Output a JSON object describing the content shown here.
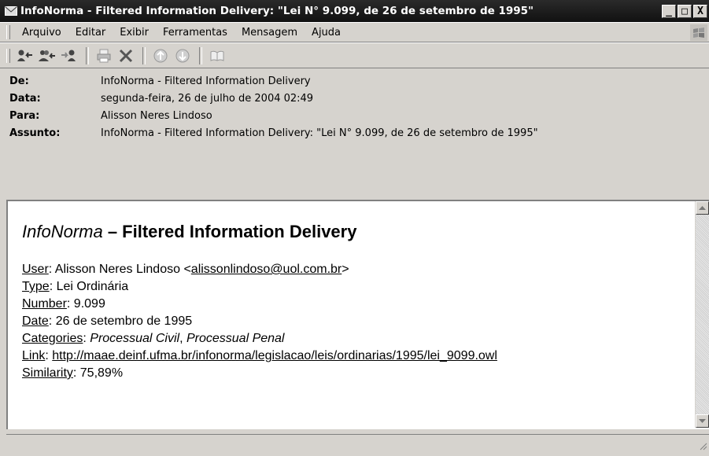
{
  "window": {
    "title": "InfoNorma - Filtered Information Delivery: \"Lei N° 9.099, de 26 de setembro de 1995\"",
    "app_icon": "envelope-icon",
    "buttons": [
      "minimize",
      "maximize",
      "close"
    ],
    "minimize_glyph": "_",
    "maximize_glyph": "□",
    "close_glyph": "X"
  },
  "menubar": {
    "items": [
      "Arquivo",
      "Editar",
      "Exibir",
      "Ferramentas",
      "Mensagem",
      "Ajuda"
    ],
    "logo_icon": "windows-flag-icon"
  },
  "toolbar": {
    "buttons": [
      "reply-icon",
      "reply-all-icon",
      "forward-icon",
      "print-icon",
      "delete-icon",
      "previous-icon",
      "next-icon",
      "addresses-icon"
    ]
  },
  "headers": {
    "from_label": "De:",
    "from_value": "InfoNorma - Filtered Information Delivery",
    "date_label": "Data:",
    "date_value": "segunda-feira, 26 de julho de 2004 02:49",
    "to_label": "Para:",
    "to_value": "Alisson Neres Lindoso",
    "subject_label": "Assunto:",
    "subject_value": "InfoNorma - Filtered Information Delivery: \"Lei N° 9.099, de 26 de setembro de 1995\""
  },
  "message": {
    "title_brand": "InfoNorma",
    "title_rest": " – Filtered Information Delivery",
    "user_label": "User",
    "user_name": "Alisson Neres Lindoso",
    "user_email": "alissonlindoso@uol.com.br",
    "type_label": "Type",
    "type_value": "Lei Ordinária",
    "number_label": "Number",
    "number_value": "9.099",
    "date_label": "Date",
    "date_value": "26 de setembro de 1995",
    "categories_label": "Categories",
    "category_1": "Processual Civil",
    "category_2": "Processual Penal",
    "link_label": "Link",
    "link_url": "http://maae.deinf.ufma.br/infonorma/legislacao/leis/ordinarias/1995/lei_9099.owl",
    "similarity_label": "Similarity",
    "similarity_value": "75,89%"
  }
}
